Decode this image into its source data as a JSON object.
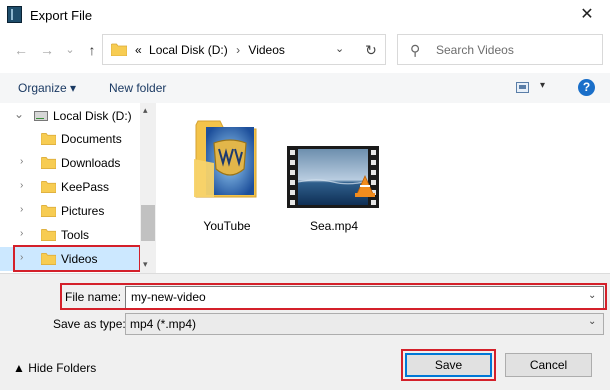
{
  "window": {
    "title": "Export File",
    "close_glyph": "✕"
  },
  "nav": {
    "back_glyph": "←",
    "forward_glyph": "→",
    "recent_glyph": "⌄",
    "up_glyph": "↑",
    "address": {
      "prefix": "«",
      "segments": [
        "Local Disk (D:)",
        "Videos"
      ],
      "separator": "›",
      "chevron_glyph": "⌄",
      "refresh_glyph": "↻"
    },
    "search": {
      "placeholder": "Search Videos",
      "icon_glyph": "⚲"
    }
  },
  "toolbar": {
    "organize_label": "Organize ▾",
    "new_folder_label": "New folder",
    "view_arrow_glyph": "▾",
    "help_glyph": "?"
  },
  "tree": {
    "drive": {
      "label": "Local Disk (D:)",
      "chevron": "⌄"
    },
    "folders": [
      {
        "label": "Documents",
        "chevron": ""
      },
      {
        "label": "Downloads",
        "chevron": "›"
      },
      {
        "label": "KeePass",
        "chevron": "›"
      },
      {
        "label": "Pictures",
        "chevron": "›"
      },
      {
        "label": "Tools",
        "chevron": "›"
      },
      {
        "label": "Videos",
        "chevron": "›",
        "selected": true
      }
    ],
    "scroll_up_glyph": "▴",
    "scroll_down_glyph": "▾"
  },
  "files": [
    {
      "name": "YouTube",
      "type": "folder-icon"
    },
    {
      "name": "Sea.mp4",
      "type": "video-icon"
    }
  ],
  "form": {
    "file_name_label": "File name:",
    "file_name_value": "my-new-video",
    "save_as_type_label": "Save as type:",
    "save_as_type_value": "mp4 (*.mp4)",
    "dropdown_glyph": "⌄"
  },
  "footer": {
    "hide_folders_label": "▲  Hide Folders",
    "save_label": "Save",
    "cancel_label": "Cancel"
  },
  "colors": {
    "highlight": "#d4202a",
    "selected_bg": "#cce8ff",
    "link_text": "#1b3a63",
    "folder_yellow": "#f7cc52",
    "help_blue": "#1a6fc9"
  }
}
